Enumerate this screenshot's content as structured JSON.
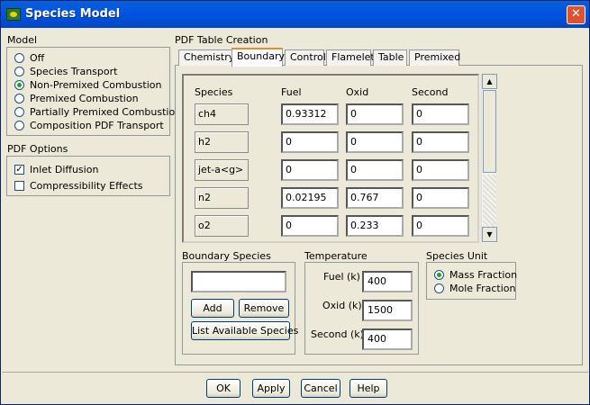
{
  "window": {
    "title": "Species Model",
    "close_label": "✕"
  },
  "model": {
    "label": "Model",
    "options": [
      {
        "label": "Off",
        "selected": false
      },
      {
        "label": "Species Transport",
        "selected": false
      },
      {
        "label": "Non-Premixed Combustion",
        "selected": true
      },
      {
        "label": "Premixed Combustion",
        "selected": false
      },
      {
        "label": "Partially Premixed Combustion",
        "selected": false
      },
      {
        "label": "Composition PDF Transport",
        "selected": false
      }
    ]
  },
  "pdf_options": {
    "label": "PDF Options",
    "items": [
      {
        "label": "Inlet Diffusion",
        "checked": true
      },
      {
        "label": "Compressibility Effects",
        "checked": false
      }
    ]
  },
  "pdf_table": {
    "label": "PDF Table Creation",
    "tabs": [
      "Chemistry",
      "Boundary",
      "Control",
      "Flamelet",
      "Table",
      "Premixed"
    ],
    "active_tab": "Boundary",
    "columns": [
      "Species",
      "Fuel",
      "Oxid",
      "Second"
    ],
    "rows": [
      {
        "species": "ch4",
        "fuel": "0.93312",
        "oxid": "0",
        "second": "0"
      },
      {
        "species": "h2",
        "fuel": "0",
        "oxid": "0",
        "second": "0"
      },
      {
        "species": "jet-a<g>",
        "fuel": "0",
        "oxid": "0",
        "second": "0"
      },
      {
        "species": "n2",
        "fuel": "0.02195",
        "oxid": "0.767",
        "second": "0"
      },
      {
        "species": "o2",
        "fuel": "0",
        "oxid": "0.233",
        "second": "0"
      }
    ]
  },
  "boundary_species": {
    "label": "Boundary Species",
    "input_value": "",
    "add_label": "Add",
    "remove_label": "Remove",
    "list_label": "List Available Species"
  },
  "temperature": {
    "label": "Temperature",
    "fuel_label": "Fuel (k)",
    "fuel_value": "400",
    "oxid_label": "Oxid (k)",
    "oxid_value": "1500",
    "second_label": "Second (k)",
    "second_value": "400"
  },
  "species_unit": {
    "label": "Species Unit",
    "options": [
      {
        "label": "Mass Fraction",
        "selected": true
      },
      {
        "label": "Mole Fraction",
        "selected": false
      }
    ]
  },
  "footer": {
    "ok": "OK",
    "apply": "Apply",
    "cancel": "Cancel",
    "help": "Help"
  },
  "icons": {
    "close": "close-icon",
    "scroll_up": "arrow-up-icon",
    "scroll_down": "arrow-down-icon",
    "app": "app-icon"
  }
}
